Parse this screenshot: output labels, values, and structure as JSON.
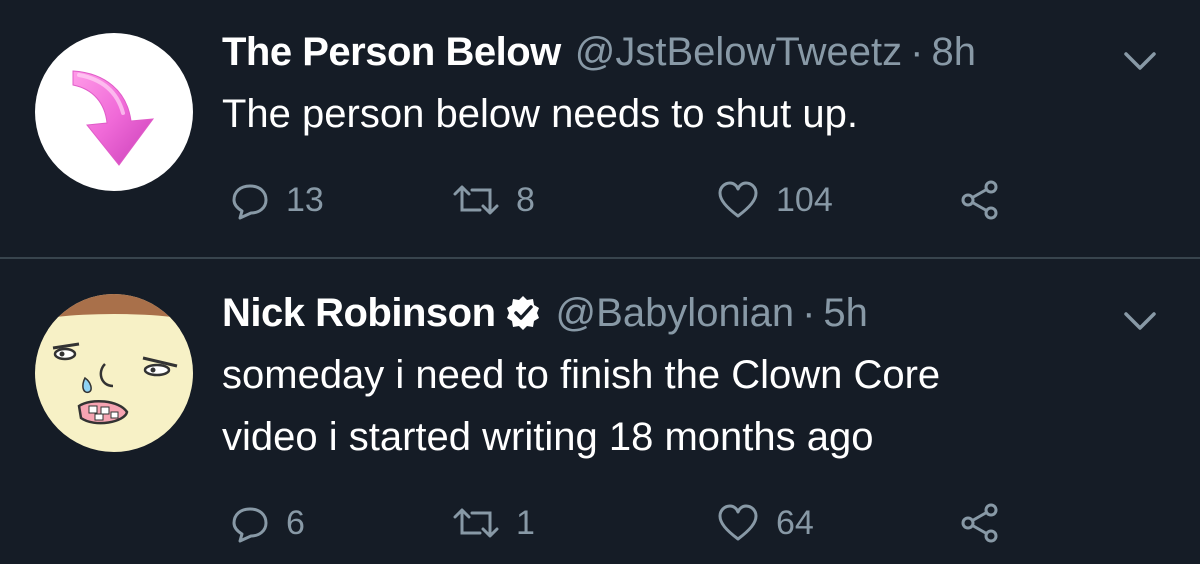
{
  "colors": {
    "background": "#151c26",
    "divider": "#38444d",
    "secondary_text": "#8899a6",
    "primary_text": "#ffffff"
  },
  "tweets": [
    {
      "name": "The Person Below",
      "handle": "@JstBelowTweetz",
      "separator": "·",
      "time": "8h",
      "verified": false,
      "avatar": "pink-down-arrow-avatar",
      "text": "The person below needs to shut up.",
      "replies": "13",
      "retweets": "8",
      "likes": "104"
    },
    {
      "name": "Nick Robinson",
      "handle": "@Babylonian",
      "separator": "·",
      "time": "5h",
      "verified": true,
      "avatar": "cartoon-face-avatar",
      "text_lines": [
        "someday i need to finish the Clown Core",
        "video i started writing 18 months ago"
      ],
      "replies": "6",
      "retweets": "1",
      "likes": "64"
    }
  ],
  "icons": {
    "reply": "reply-icon",
    "retweet": "retweet-icon",
    "like": "heart-icon",
    "share": "share-icon",
    "menu": "chevron-down-icon",
    "verified": "verified-badge-icon"
  }
}
